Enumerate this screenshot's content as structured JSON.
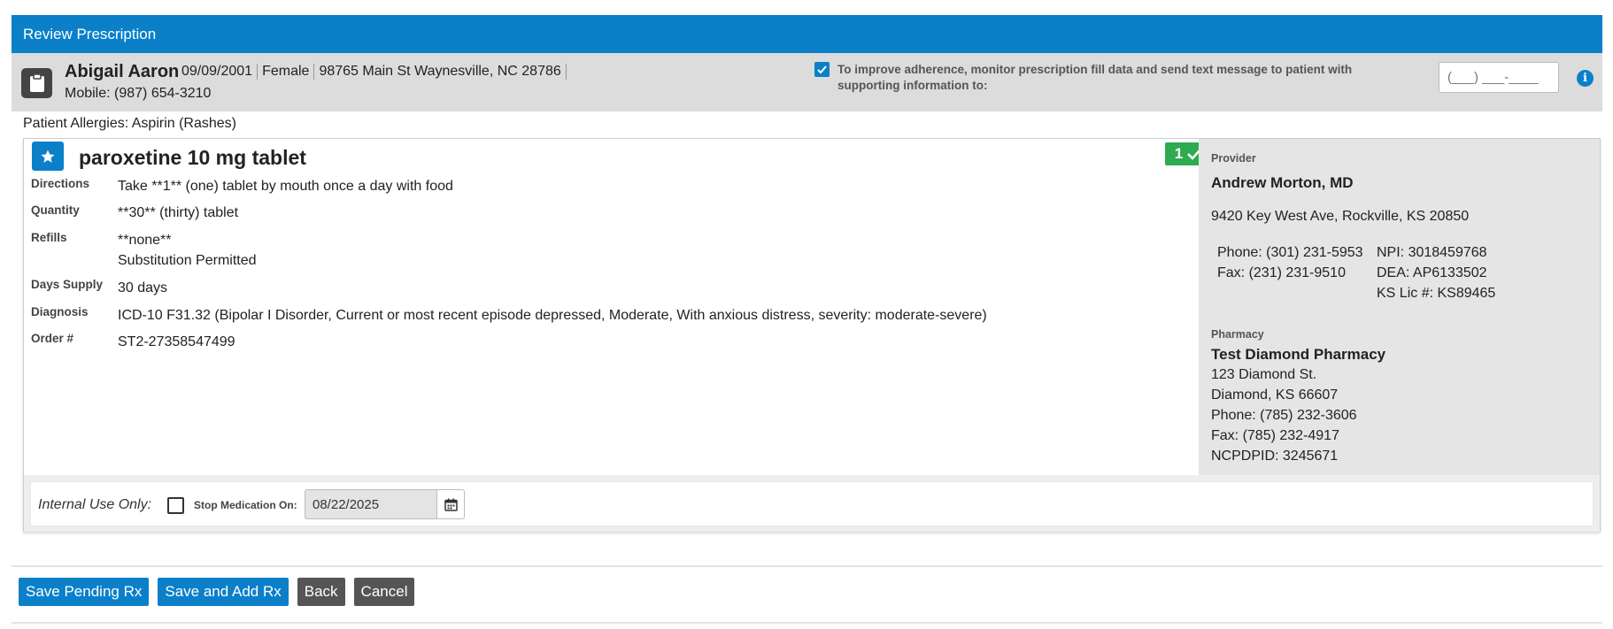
{
  "window": {
    "title": "Review Prescription"
  },
  "patient": {
    "name": "Abigail Aaron",
    "dob": "09/09/2001",
    "sex": "Female",
    "address": "98765 Main St Waynesville, NC 28786",
    "mobile": "Mobile: (987) 654-3210",
    "allergies": "Patient Allergies: Aspirin (Rashes)"
  },
  "adherence": {
    "checked": true,
    "text": "To improve adherence, monitor prescription fill data and send text message to patient with supporting information to:",
    "phone_placeholder": "(___) ___-____"
  },
  "rx": {
    "drug_name": "paroxetine 10 mg tablet",
    "badge_count": "1",
    "fields": {
      "directions_label": "Directions",
      "directions_value": "Take **1** (one) tablet by mouth once a day with food",
      "quantity_label": "Quantity",
      "quantity_value": "**30** (thirty) tablet",
      "refills_label": "Refills",
      "refills_value": "**none**",
      "substitution": "Substitution Permitted",
      "days_supply_label": "Days Supply",
      "days_supply_value": "30 days",
      "diagnosis_label": "Diagnosis",
      "diagnosis_value": "ICD-10 F31.32 (Bipolar I Disorder, Current or most recent episode depressed, Moderate, With anxious distress, severity: moderate-severe)",
      "order_label": "Order #",
      "order_value": "ST2-27358547499"
    }
  },
  "provider": {
    "label": "Provider",
    "name": "Andrew Morton, MD",
    "address": "9420 Key West Ave, Rockville, KS 20850",
    "phone": "Phone: (301) 231-5953",
    "npi": "NPI: 3018459768",
    "fax": "Fax: (231) 231-9510",
    "dea": "DEA: AP6133502",
    "license": "KS Lic #: KS89465"
  },
  "pharmacy": {
    "label": "Pharmacy",
    "name": "Test Diamond Pharmacy",
    "street": "123 Diamond St.",
    "city": "Diamond, KS 66607",
    "phone": "Phone: (785) 232-3606",
    "fax": "Fax: (785) 232-4917",
    "ncpdpid": "NCPDPID: 3245671"
  },
  "internal": {
    "label": "Internal Use Only:",
    "stop_label": "Stop Medication On:",
    "stop_date": "08/22/2025"
  },
  "buttons": {
    "save_pending": "Save Pending Rx",
    "save_and_add": "Save and Add Rx",
    "back": "Back",
    "cancel": "Cancel"
  },
  "colors": {
    "brand_blue": "#0b80c9",
    "success_green": "#2eab4f",
    "dark_button": "#555555"
  }
}
